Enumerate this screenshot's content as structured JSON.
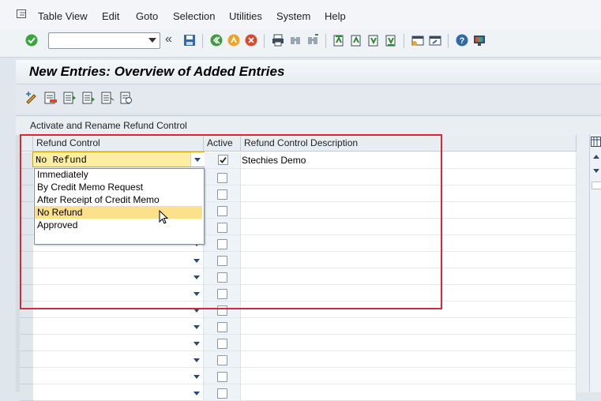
{
  "menu": [
    "Table View",
    "Edit",
    "Goto",
    "Selection",
    "Utilities",
    "System",
    "Help"
  ],
  "toolbar": {
    "command_value": "",
    "icons": [
      "enter-icon",
      "back-icon",
      "exit-icon",
      "cancel-icon",
      "print-icon",
      "find-icon",
      "find-next-icon",
      "first-page-icon",
      "previous-page-icon",
      "next-page-icon",
      "last-page-icon",
      "create-session-icon",
      "shortcut-icon",
      "help-icon",
      "layout-icon"
    ]
  },
  "title": "New Entries: Overview of Added Entries",
  "table": {
    "title": "Activate and Rename Refund Control",
    "headers": {
      "refund_control": "Refund Control",
      "active": "Active",
      "description": "Refund Control Description"
    },
    "first_row": {
      "refund_control": "No Refund",
      "active": true,
      "description": "Stechies Demo"
    }
  },
  "dropdown": {
    "options": [
      "Immediately",
      "By Credit Memo Request",
      "After Receipt of Credit Memo",
      "No Refund",
      "Approved"
    ],
    "selected_index": 3
  },
  "colors": {
    "highlight": "#fde08a",
    "annotation": "#d52a36",
    "input_bg": "#ffeda1"
  }
}
